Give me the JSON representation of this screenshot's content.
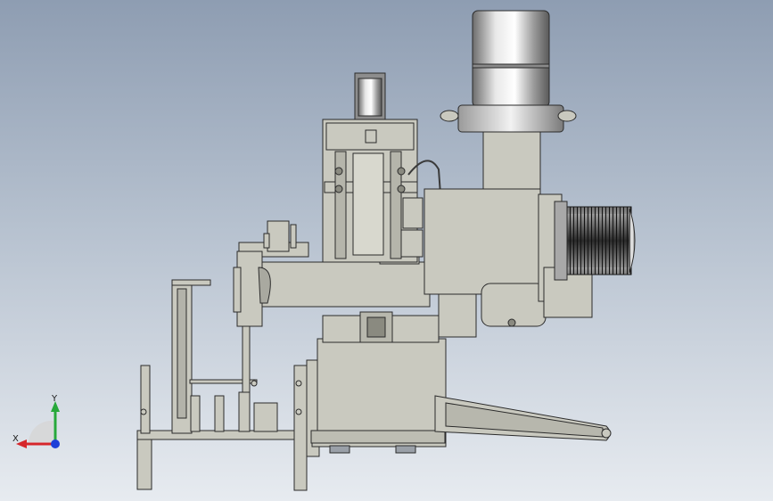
{
  "viewport": {
    "background_top": "#8e9db2",
    "background_bottom": "#e7ebf0"
  },
  "model": {
    "body_color": "#c9c9bf",
    "edge_color": "#2b2b2b",
    "motor_color": "#d9d9d9",
    "fin_color": "#3a3a3a",
    "components": [
      "gear-motor",
      "servo-motor",
      "ball-screw-frame",
      "side-motor",
      "main-housing",
      "support-frame",
      "pivot-arm"
    ]
  },
  "triad": {
    "x_label": "X",
    "y_label": "Y",
    "x_color": "#d6262b",
    "y_color": "#27a83a",
    "z_color": "#1d3fd8"
  }
}
